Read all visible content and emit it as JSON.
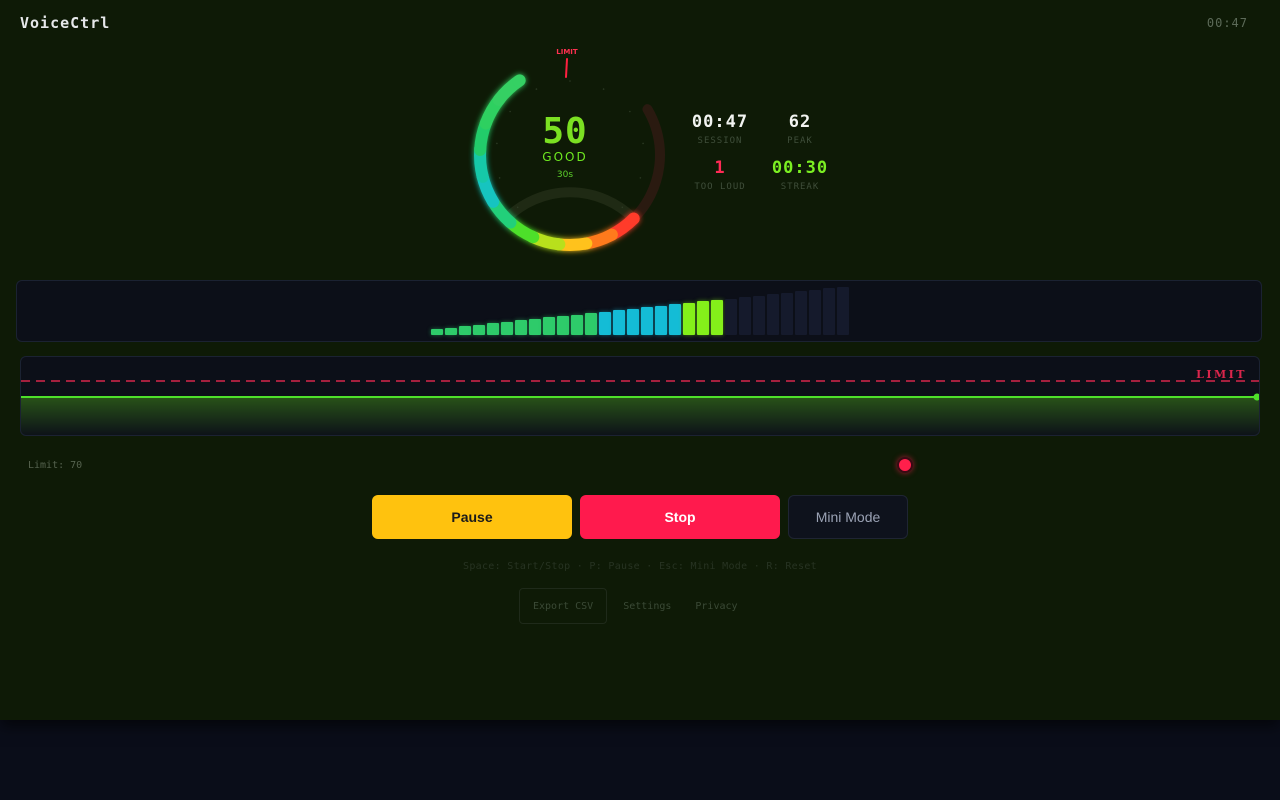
{
  "app": {
    "title": "VoiceCtrl",
    "clock": "00:47"
  },
  "gauge": {
    "value": "50",
    "status": "GOOD",
    "duration": "30s",
    "limit_label": "LIMIT",
    "level_fraction": 0.5,
    "limit_fraction": 0.7
  },
  "stats": [
    {
      "value": "00:47",
      "label": "SESSION",
      "color": "#f2f4f1"
    },
    {
      "value": "62",
      "label": "PEAK",
      "color": "#f2f4f1"
    },
    {
      "value": "1",
      "label": "TOO LOUD",
      "color": "#ff2a55"
    },
    {
      "value": "00:30",
      "label": "STREAK",
      "color": "#7bef22"
    }
  ],
  "meter": {
    "active_segments": 21,
    "total_segments": 30
  },
  "history": {
    "limit_label": "LIMIT",
    "line_color": "#4ee02a",
    "limit_color": "#ff2a55"
  },
  "limit": {
    "label": "Limit: 70",
    "value": 70
  },
  "buttons": {
    "pause": "Pause",
    "stop": "Stop",
    "mini": "Mini Mode"
  },
  "shortcuts": "Space: Start/Stop · P: Pause · Esc: Mini Mode · R: Reset",
  "footer": {
    "export": "Export CSV",
    "settings": "Settings",
    "privacy": "Privacy"
  },
  "colors": {
    "accent": "#7be022",
    "danger": "#ff1a4d",
    "warning": "#ffc20e",
    "background": "#0e1a06"
  }
}
